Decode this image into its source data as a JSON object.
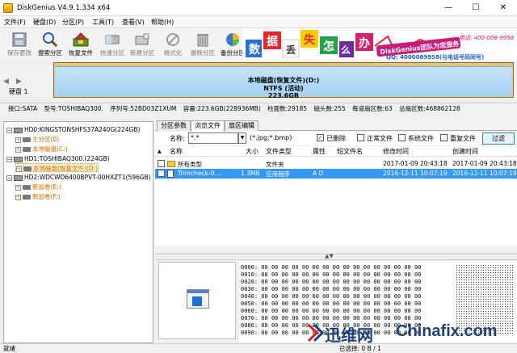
{
  "window": {
    "title": "DiskGenius V4.9.1.334 x64"
  },
  "menu": [
    "文件(F)",
    "硬盘(D)",
    "分区(P)",
    "工具(T)",
    "查看(V)",
    "帮助(H)"
  ],
  "toolbar": [
    {
      "label": "保存更改",
      "icon": "save-icon",
      "enabled": false
    },
    {
      "label": "搜索分区",
      "icon": "magnifier-icon",
      "enabled": true
    },
    {
      "label": "恢复文件",
      "icon": "recover-files-icon",
      "enabled": true
    },
    {
      "label": "快速分区",
      "icon": "quick-partition-icon",
      "enabled": false
    },
    {
      "label": "新建分区",
      "icon": "new-partition-icon",
      "enabled": false
    },
    {
      "label": "格式化",
      "icon": "format-icon",
      "enabled": false
    },
    {
      "label": "删除分区",
      "icon": "trash-icon",
      "enabled": false
    },
    {
      "label": "备份分区",
      "icon": "pie-icon",
      "enabled": true
    }
  ],
  "banner": {
    "chars": [
      "数",
      "据",
      "丢",
      "失",
      "怎",
      "么",
      "办"
    ],
    "team": "DiskGenius团队为您服务",
    "phone": "电话: 400-008-9958",
    "qq": "QQ: 4000089958(与电话号码同号)"
  },
  "disk_strip": {
    "label": "硬盘 1",
    "partition_name": "本地磁盘(恢复文件)(D:)",
    "fs": "NTFS (活动)",
    "size": "223.6GB"
  },
  "info": [
    "接口:SATA",
    "型号:TOSHIBAQ300.",
    "序列号:52BD03Z1XUM",
    "容量:223.6GB(228936MB)",
    "柱面数:29185",
    "磁头数:255",
    "每道扇区数:63",
    "总扇区数:468862128"
  ],
  "tree": [
    {
      "text": "HD0:KINGSTONSHFS37A240G(224GB)",
      "level": 0,
      "kind": "disk",
      "color": "black"
    },
    {
      "text": "主分区(0)",
      "level": 1,
      "kind": "part",
      "color": "orange"
    },
    {
      "text": "本地磁盘(C:)",
      "level": 1,
      "kind": "part",
      "color": "orange"
    },
    {
      "text": "HD1:TOSHIBAQ300.(224GB)",
      "level": 0,
      "kind": "disk",
      "color": "black"
    },
    {
      "text": "本地磁盘(恢复文件)(D:)",
      "level": 1,
      "kind": "part",
      "color": "orange",
      "selected": true
    },
    {
      "text": "HD2:WDCWD6400BPVT-00HXZT1(596GB)",
      "level": 0,
      "kind": "disk",
      "color": "black"
    },
    {
      "text": "新加卷(E:)",
      "level": 1,
      "kind": "part",
      "color": "orange"
    },
    {
      "text": "新加卷(F:)",
      "level": 1,
      "kind": "part",
      "color": "orange"
    }
  ],
  "tabs": [
    "分区参数",
    "浏览文件",
    "扇区编辑"
  ],
  "active_tab": 1,
  "filter": {
    "label": "名称:",
    "value": "*.*",
    "hint": "(*.jpg;*.bmp)",
    "options": [
      {
        "label": "已删除",
        "checked": true
      },
      {
        "label": "正常文件",
        "checked": false
      },
      {
        "label": "系统文件",
        "checked": false
      },
      {
        "label": "重复文件",
        "checked": false
      }
    ],
    "button": "过滤"
  },
  "columns": [
    "名称",
    "大小",
    "文件类型",
    "属性",
    "短文件名",
    "修改时间",
    "创建时间"
  ],
  "rows": [
    {
      "name": "所有类型",
      "size": "",
      "type": "文件夹",
      "attr": "",
      "short": "",
      "modified": "2017-01-09 20:43:18",
      "created": "2017-01-09 20:43:18",
      "selected": false,
      "icon": "folder"
    },
    {
      "name": "Trimcheck-0....",
      "size": "1.3MB",
      "type": "应用程序",
      "attr": "A D",
      "short": "",
      "modified": "2016-12-11 10:07:19",
      "created": "2016-12-11 10:07:19",
      "selected": true,
      "icon": "file"
    }
  ],
  "hex_offsets": [
    "0000:",
    "0010:",
    "0020:",
    "0030:",
    "0040:",
    "0050:",
    "0060:",
    "0070:",
    "0080:",
    "0090:"
  ],
  "hex_bytes": "00 00 00 00 00 00 00 00 00 00 00 00 00 00 00 00",
  "status": {
    "ready": "就绪",
    "selected": "已选择: 0 B / 1"
  },
  "watermark": {
    "brand": "迅维网",
    "site": "Chinafix.com"
  }
}
